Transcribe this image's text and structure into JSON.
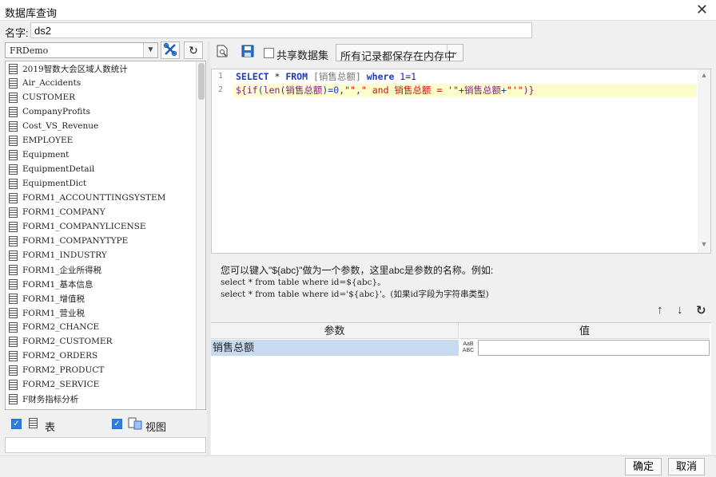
{
  "window": {
    "title": "数据库查询",
    "close_glyph": "✕"
  },
  "name_field": {
    "label": "名字:",
    "value": "ds2"
  },
  "left_panel": {
    "database": "FRDemo",
    "tables": [
      "2019智数大会区域人数统计",
      "Air_Accidents",
      "CUSTOMER",
      "CompanyProfits",
      "Cost_VS_Revenue",
      "EMPLOYEE",
      "Equipment",
      "EquipmentDetail",
      "EquipmentDict",
      "FORM1_ACCOUNTTINGSYSTEM",
      "FORM1_COMPANY",
      "FORM1_COMPANYLICENSE",
      "FORM1_COMPANYTYPE",
      "FORM1_INDUSTRY",
      "FORM1_企业所得税",
      "FORM1_基本信息",
      "FORM1_增值税",
      "FORM1_营业税",
      "FORM2_CHANCE",
      "FORM2_CUSTOMER",
      "FORM2_ORDERS",
      "FORM2_PRODUCT",
      "FORM2_SERVICE",
      "F财务指标分析"
    ],
    "show_tables_label": "表",
    "show_views_label": "视图",
    "show_tables_checked": true,
    "show_views_checked": true
  },
  "toolbar": {
    "share_dataset_label": "共享数据集",
    "share_dataset_checked": false,
    "memory_mode": "所有记录都保存在内存中"
  },
  "sql_editor": {
    "line_numbers": [
      "1",
      "2"
    ],
    "line1": {
      "select": "SELECT",
      "star": " * ",
      "from": "FROM",
      "space": " ",
      "table": "[销售总额]",
      "where": " where ",
      "cond": "1=1"
    },
    "line2": {
      "p1": "${",
      "p2": "if",
      "p3": "(",
      "p4": "len",
      "p5": "(",
      "p6": "销售总额",
      "p7": ")=0,",
      "p8": "\"\"",
      "p9": ",",
      "p10": "\" and 销售总额 = '\"",
      "p11": "+",
      "p12": "销售总额",
      "p13": "+",
      "p14": "\"'\"",
      "p15": ")}"
    }
  },
  "hint": {
    "line1": "您可以键入\"${abc}\"做为一个参数，这里abc是参数的名称。例如:",
    "line2": "select * from table where id=${abc}。",
    "line3": "select * from table where id='${abc}'。(如果id字段为字符串类型)"
  },
  "params": {
    "header_name": "参数",
    "header_value": "值",
    "rows": [
      {
        "name": "销售总额",
        "type_glyph_top": "AaB",
        "type_glyph_bottom": "ABC",
        "value": ""
      }
    ]
  },
  "buttons": {
    "ok": "确定",
    "cancel": "取消"
  }
}
